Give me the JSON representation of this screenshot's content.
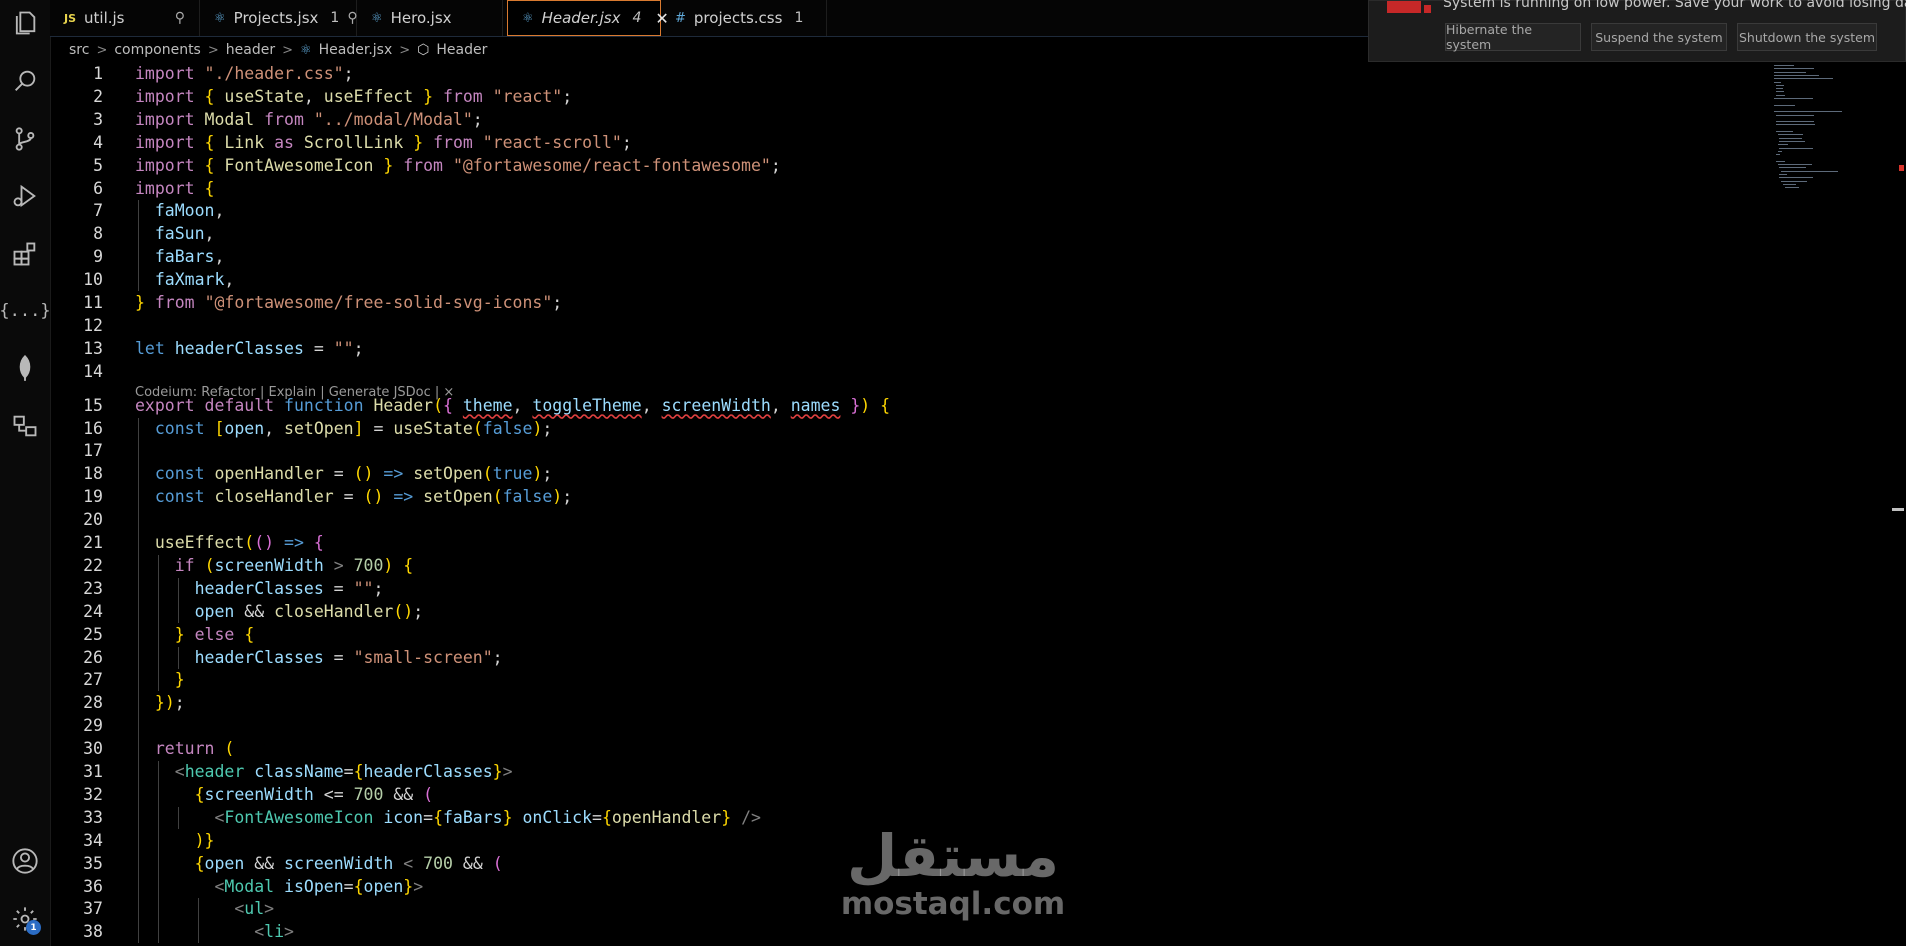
{
  "activity_bar": {
    "icons": [
      "files-icon",
      "search-icon",
      "source-control-icon",
      "run-debug-icon",
      "extensions-icon",
      "json-icon",
      "mongodb-leaf-icon",
      "remote-explorer-icon",
      "account-icon",
      "settings-gear-icon"
    ],
    "settings_badge": "1"
  },
  "tabs": [
    {
      "icon": "JS",
      "label": "util.js",
      "extra": "",
      "pinned": true
    },
    {
      "icon": "react-icon",
      "label": "Projects.jsx",
      "extra": "1",
      "pinned": true
    },
    {
      "icon": "react-icon",
      "label": "Hero.jsx",
      "extra": "",
      "pinned": false
    },
    {
      "icon": "react-icon",
      "label": "Header.jsx",
      "extra": "4",
      "active": true
    },
    {
      "icon": "#",
      "label": "projects.css",
      "extra": "1",
      "pinned": false
    }
  ],
  "breadcrumb": [
    "src",
    "components",
    "header",
    "Header.jsx",
    "Header"
  ],
  "codelens": "Codeium: Refactor | Explain | Generate JSDoc | ×",
  "notification": {
    "message": "System is running on low power. Save your work to avoid losing data",
    "buttons": [
      "Hibernate the system",
      "Suspend the system",
      "Shutdown the system"
    ]
  },
  "code_lines": [
    {
      "n": "1",
      "t": "import \"./header.css\";"
    },
    {
      "n": "2",
      "t": "import { useState, useEffect } from \"react\";"
    },
    {
      "n": "3",
      "t": "import Modal from \"../modal/Modal\";"
    },
    {
      "n": "4",
      "t": "import { Link as ScrollLink } from \"react-scroll\";"
    },
    {
      "n": "5",
      "t": "import { FontAwesomeIcon } from \"@fortawesome/react-fontawesome\";"
    },
    {
      "n": "6",
      "t": "import {"
    },
    {
      "n": "7",
      "t": "  faMoon,"
    },
    {
      "n": "8",
      "t": "  faSun,"
    },
    {
      "n": "9",
      "t": "  faBars,"
    },
    {
      "n": "10",
      "t": "  faXmark,"
    },
    {
      "n": "11",
      "t": "} from \"@fortawesome/free-solid-svg-icons\";"
    },
    {
      "n": "12",
      "t": ""
    },
    {
      "n": "13",
      "t": "let headerClasses = \"\";"
    },
    {
      "n": "14",
      "t": ""
    },
    {
      "n": "15",
      "t": "export default function Header({ theme, toggleTheme, screenWidth, names }) {"
    },
    {
      "n": "16",
      "t": "  const [open, setOpen] = useState(false);"
    },
    {
      "n": "17",
      "t": ""
    },
    {
      "n": "18",
      "t": "  const openHandler = () => setOpen(true);"
    },
    {
      "n": "19",
      "t": "  const closeHandler = () => setOpen(false);"
    },
    {
      "n": "20",
      "t": ""
    },
    {
      "n": "21",
      "t": "  useEffect(() => {"
    },
    {
      "n": "22",
      "t": "    if (screenWidth > 700) {"
    },
    {
      "n": "23",
      "t": "      headerClasses = \"\";"
    },
    {
      "n": "24",
      "t": "      open && closeHandler();"
    },
    {
      "n": "25",
      "t": "    } else {"
    },
    {
      "n": "26",
      "t": "      headerClasses = \"small-screen\";"
    },
    {
      "n": "27",
      "t": "    }"
    },
    {
      "n": "28",
      "t": "  });"
    },
    {
      "n": "29",
      "t": ""
    },
    {
      "n": "30",
      "t": "  return ("
    },
    {
      "n": "31",
      "t": "    <header className={headerClasses}>"
    },
    {
      "n": "32",
      "t": "      {screenWidth <= 700 && ("
    },
    {
      "n": "33",
      "t": "        <FontAwesomeIcon icon={faBars} onClick={openHandler} />"
    },
    {
      "n": "34",
      "t": "      )}"
    },
    {
      "n": "35",
      "t": "      {open && screenWidth < 700 && ("
    },
    {
      "n": "36",
      "t": "        <Modal isOpen={open}>"
    },
    {
      "n": "37",
      "t": "          <ul>"
    },
    {
      "n": "38",
      "t": "            <li>"
    }
  ],
  "watermark": {
    "arabic": "مستقل",
    "latin": "mostaql.com"
  }
}
